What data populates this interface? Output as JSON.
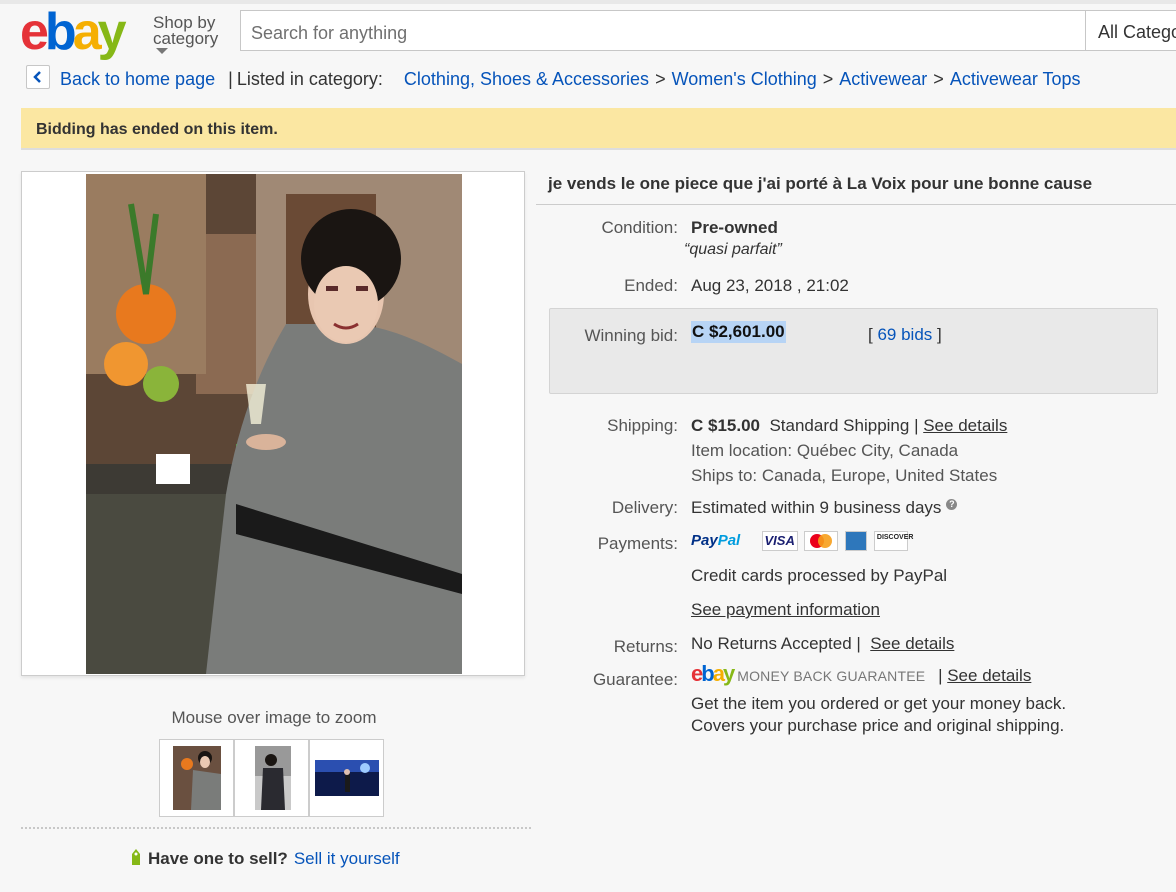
{
  "header": {
    "logo": "ebay",
    "shop_by": "Shop by",
    "category": "category",
    "search_placeholder": "Search for anything",
    "category_select": "All Categories"
  },
  "breadcrumb": {
    "back": "Back to home page",
    "listed_in": "Listed in category:",
    "items": [
      "Clothing, Shoes & Accessories",
      "Women's Clothing",
      "Activewear",
      "Activewear Tops"
    ],
    "separator": ">"
  },
  "banner": {
    "text": "Bidding has ended on this item."
  },
  "gallery": {
    "zoom_hint": "Mouse over image to zoom",
    "thumbnail_count": 3
  },
  "sell": {
    "question": "Have one to sell?",
    "link": "Sell it yourself"
  },
  "item": {
    "title": "je vends le one piece que j'ai porté à La Voix pour une bonne cause",
    "condition_label": "Condition:",
    "condition": "Pre-owned",
    "condition_note": "quasi parfait",
    "ended_label": "Ended:",
    "ended": "Aug 23, 2018 , 21:02",
    "winning_label": "Winning bid:",
    "winning_bid": "C $2,601.00",
    "bids": "69 bids",
    "shipping_label": "Shipping:",
    "shipping_price": "C $15.00",
    "shipping_method": "Standard Shipping",
    "see_details": "See details",
    "item_location": "Item location: Québec City, Canada",
    "ships_to": "Ships to: Canada, Europe, United States",
    "delivery_label": "Delivery:",
    "delivery": "Estimated within 9 business days",
    "payments_label": "Payments:",
    "paypal_a": "Pay",
    "paypal_b": "Pal",
    "cards": [
      "VISA",
      "MasterCard",
      "AMERICAN EXPRESS",
      "DISCOVER"
    ],
    "credit_cards": "Credit cards processed by PayPal",
    "see_payment": "See payment information",
    "returns_label": "Returns:",
    "returns": "No Returns Accepted",
    "guarantee_label": "Guarantee:",
    "mbg": "MONEY BACK GUARANTEE",
    "guarantee_line1": "Get the item you ordered or get your money back.",
    "guarantee_line2": "Covers your purchase price and original shipping."
  }
}
